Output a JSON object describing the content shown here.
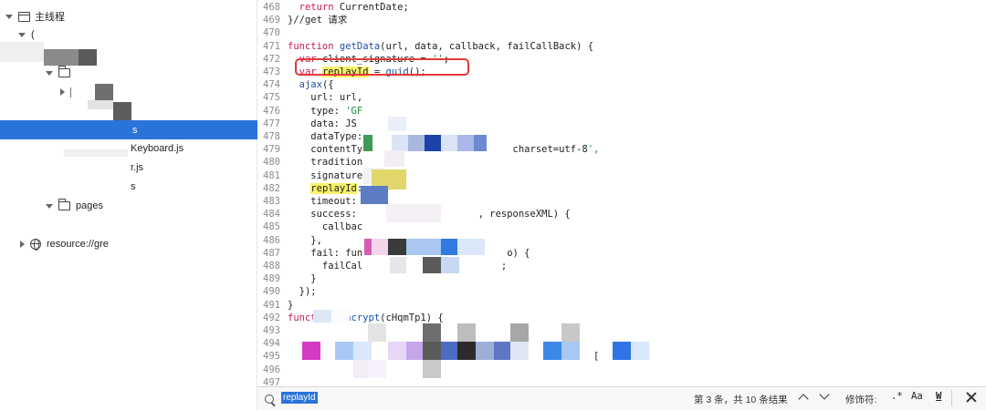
{
  "tree": {
    "root_label": "主线程",
    "item_partial": "(",
    "selected_suffix": "s",
    "keyboard_file": "Keyboard.js",
    "file_r": "r.js",
    "file_s": "s",
    "folder_pages": "pages",
    "resource_label": "resource://gre"
  },
  "code_lines": [
    {
      "n": "468",
      "t": "  return CurrentDate;"
    },
    {
      "n": "469",
      "t": "}//get 请求"
    },
    {
      "n": "470",
      "t": ""
    },
    {
      "n": "471",
      "t": "function getData(url, data, callback, failCallBack) {"
    },
    {
      "n": "472",
      "t": "  var client_signature = '';"
    },
    {
      "n": "473",
      "t": "  var replayId = guid();"
    },
    {
      "n": "474",
      "t": "  ajax({"
    },
    {
      "n": "475",
      "t": "    url: url,"
    },
    {
      "n": "476",
      "t": "    type: 'GF"
    },
    {
      "n": "477",
      "t": "    data: JS"
    },
    {
      "n": "478",
      "t": "    dataType:"
    },
    {
      "n": "479",
      "t": "    contentTy                          charset=utf-8',"
    },
    {
      "n": "480",
      "t": "    tradition     t"
    },
    {
      "n": "481",
      "t": "    signature"
    },
    {
      "n": "482",
      "t": "    replayId:"
    },
    {
      "n": "483",
      "t": "    timeout:"
    },
    {
      "n": "484",
      "t": "    success:                     , responseXML) {"
    },
    {
      "n": "485",
      "t": "      callbac"
    },
    {
      "n": "486",
      "t": "    },"
    },
    {
      "n": "487",
      "t": "    fail: fun                         o) {"
    },
    {
      "n": "488",
      "t": "      failCal                        ;"
    },
    {
      "n": "489",
      "t": "    }"
    },
    {
      "n": "490",
      "t": "  });"
    },
    {
      "n": "491",
      "t": "}"
    },
    {
      "n": "492",
      "t": "function encrypt(cHqmTp1) {"
    },
    {
      "n": "493",
      "t": ""
    },
    {
      "n": "494",
      "t": ""
    },
    {
      "n": "495",
      "t": "                                                     ["
    },
    {
      "n": "496",
      "t": ""
    },
    {
      "n": "497",
      "t": ""
    }
  ],
  "search": {
    "query": "replayId",
    "result_text": "第 3 条，共 10 条结果",
    "modifiers_label": "修饰符:",
    "regex_btn": ".*",
    "case_btn": "Aa",
    "word_btn": "W"
  },
  "colors": {
    "selection": "#2a73d9",
    "highlight_box": "#e53935",
    "match_highlight": "#f6f26a"
  }
}
